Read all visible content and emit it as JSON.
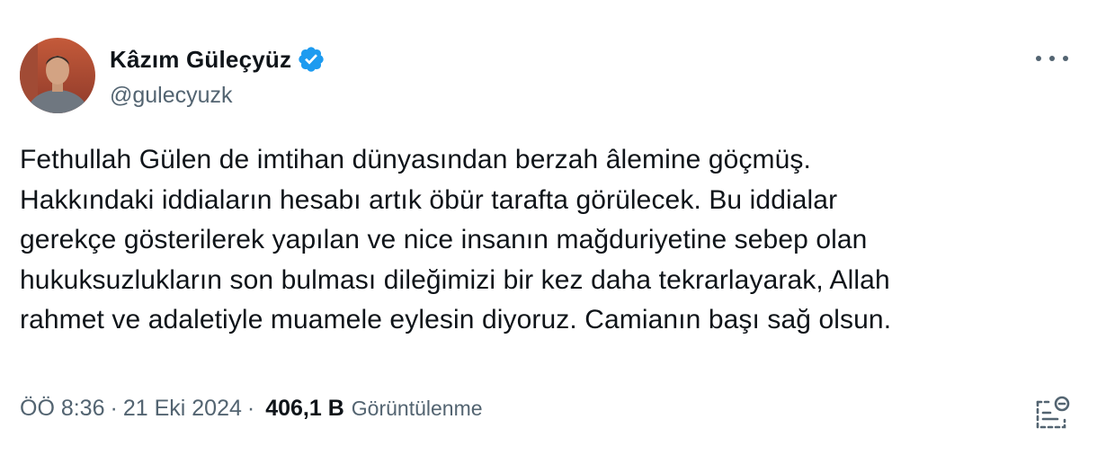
{
  "author": {
    "name": "Kâzım Güleçyüz",
    "handle": "@gulecyuzk",
    "verified_color": "#1d9bf0"
  },
  "tweet": {
    "lines": [
      "Fethullah Gülen de imtihan dünyasından berzah âlemine göçmüş.",
      "Hakkındaki iddiaların hesabı artık öbür tarafta görülecek. Bu iddialar",
      "gerekçe gösterilerek yapılan ve nice insanın mağduriyetine sebep olan",
      "hukuksuzlukların son bulması dileğimizi bir kez daha tekrarlayarak, Allah",
      "rahmet ve adaletiyle muamele eylesin diyoruz. Camianın başı sağ olsun."
    ]
  },
  "meta": {
    "time": "ÖÖ 8:36",
    "separator": "·",
    "date": "21 Eki 2024",
    "view_count": "406,1 B",
    "views_label": "Görüntülenme"
  },
  "icons": {
    "more": "more-options-icon",
    "analytics": "grok-icon"
  }
}
